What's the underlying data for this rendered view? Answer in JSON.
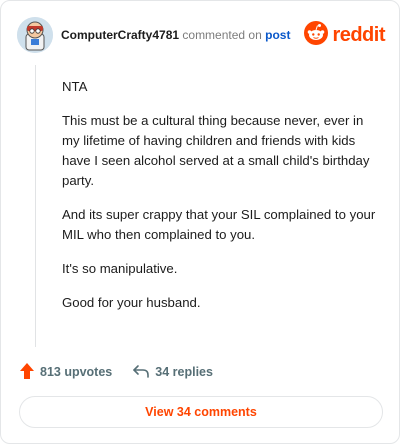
{
  "header": {
    "username": "ComputerCrafty4781",
    "action_text": "commented on",
    "post_link": "post",
    "brand_name": "reddit"
  },
  "comment": {
    "paragraphs": [
      "NTA",
      "This must be a cultural thing because never, ever in my lifetime of having children and friends with kids have I seen alcohol served at a small child's birthday party.",
      "And its super crappy that your SIL complained to your MIL who then complained to you.",
      "It's so manipulative.",
      "Good for your husband."
    ]
  },
  "actions": {
    "upvotes": "813 upvotes",
    "replies": "34 replies"
  },
  "footer": {
    "view_comments": "View 34 comments"
  },
  "colors": {
    "brand": "#ff4500",
    "link": "#0a58ca",
    "muted": "#7c7c7c"
  },
  "icons": [
    "avatar",
    "reddit-logo-icon",
    "upvote-arrow-icon",
    "reply-arrow-icon"
  ]
}
